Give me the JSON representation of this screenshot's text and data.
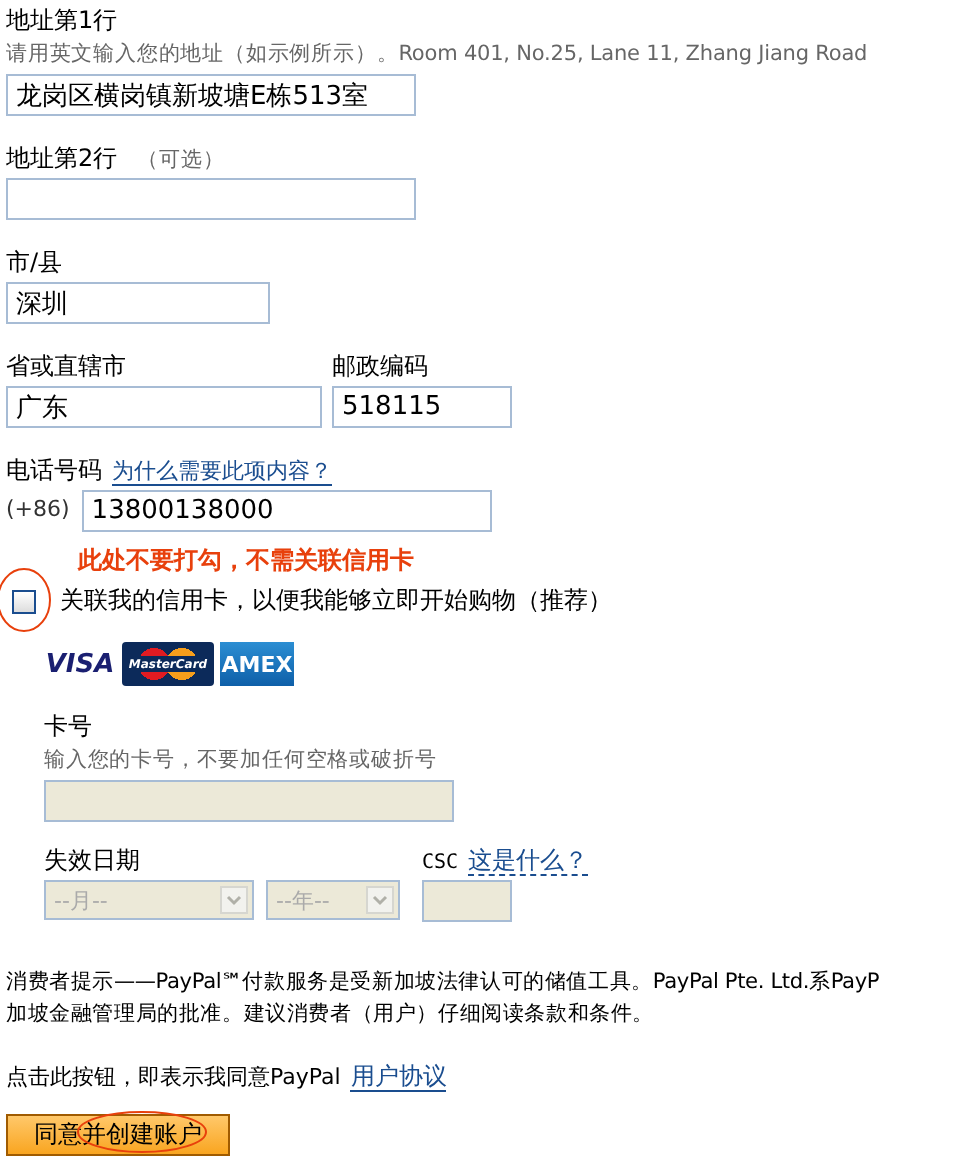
{
  "address_line1": {
    "label": "地址第1行",
    "hint": "请用英文输入您的地址（如示例所示）。Room 401, No.25, Lane 11, Zhang Jiang Road",
    "value": "龙岗区横岗镇新坡塘E栋513室"
  },
  "address_line2": {
    "label": "地址第2行",
    "optional": "（可选）"
  },
  "city": {
    "label": "市/县",
    "value": "深圳"
  },
  "province": {
    "label": "省或直辖市",
    "value": "广东"
  },
  "postal_code": {
    "label": "邮政编码",
    "value": "518115"
  },
  "phone": {
    "label": "电话号码",
    "help_link": "为什么需要此项内容？",
    "prefix": "(+86)",
    "value": "13800138000"
  },
  "annotation": "此处不要打勾，不需关联信用卡",
  "link_card": {
    "label": "关联我的信用卡，以便我能够立即开始购物（推荐）",
    "checked": false
  },
  "card_logos": [
    "VISA",
    "MasterCard",
    "AMEX"
  ],
  "card_fields_disabled": true,
  "card_number": {
    "label": "卡号",
    "hint": "输入您的卡号，不要加任何空格或破折号"
  },
  "expiry": {
    "label": "失效日期",
    "month": "--月--",
    "year": "--年--"
  },
  "csc": {
    "label": "CSC",
    "help_link": "这是什么？"
  },
  "notice_lines": [
    "消费者提示——PayPal℠付款服务是受新加坡法律认可的储值工具。PayPal Pte. Ltd.系PayP",
    "加坡金融管理局的批准。建议消费者（用户）仔细阅读条款和条件。"
  ],
  "agreement": {
    "text": "点击此按钮，即表示我同意PayPal",
    "link": "用户协议"
  },
  "submit": "同意并创建账户"
}
